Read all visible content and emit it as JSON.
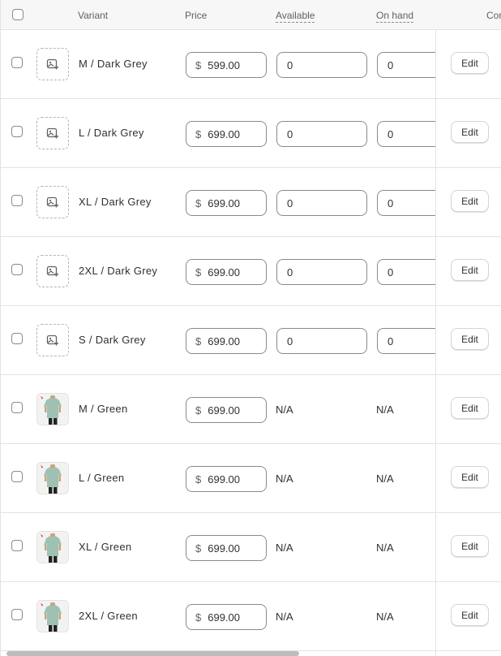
{
  "header": {
    "variant": "Variant",
    "price": "Price",
    "available": "Available",
    "on_hand": "On hand",
    "committed_partial": "Cor"
  },
  "currency_symbol": "$",
  "edit_label": "Edit",
  "rows": [
    {
      "name": "M / Dark Grey",
      "price": "599.00",
      "available": "0",
      "on_hand": "0",
      "image": "placeholder"
    },
    {
      "name": "L / Dark Grey",
      "price": "699.00",
      "available": "0",
      "on_hand": "0",
      "image": "placeholder"
    },
    {
      "name": "XL / Dark Grey",
      "price": "699.00",
      "available": "0",
      "on_hand": "0",
      "image": "placeholder"
    },
    {
      "name": "2XL / Dark Grey",
      "price": "699.00",
      "available": "0",
      "on_hand": "0",
      "image": "placeholder"
    },
    {
      "name": "S / Dark Grey",
      "price": "699.00",
      "available": "0",
      "on_hand": "0",
      "image": "placeholder"
    },
    {
      "name": "M / Green",
      "price": "699.00",
      "available": "N/A",
      "on_hand": "N/A",
      "image": "shirt-photo"
    },
    {
      "name": "L / Green",
      "price": "699.00",
      "available": "N/A",
      "on_hand": "N/A",
      "image": "shirt-photo"
    },
    {
      "name": "XL / Green",
      "price": "699.00",
      "available": "N/A",
      "on_hand": "N/A",
      "image": "shirt-photo"
    },
    {
      "name": "2XL / Green",
      "price": "699.00",
      "available": "N/A",
      "on_hand": "N/A",
      "image": "shirt-photo"
    }
  ],
  "colors": {
    "header_bg": "#f7f7f7",
    "border": "#e3e3e3",
    "input_border": "#8a8a8a",
    "shirt": "#9fc1b3"
  }
}
